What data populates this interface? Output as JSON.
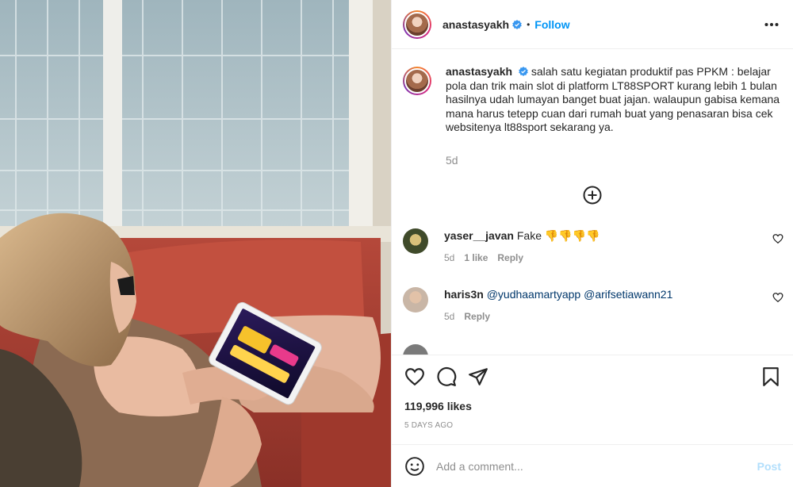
{
  "post": {
    "author": "anastasyakh",
    "follow_label": "Follow",
    "dot": "•",
    "caption": "salah satu kegiatan produktif pas PPKM : belajar pola dan trik main slot di platform LT88SPORT kurang lebih 1 bulan hasilnya udah lumayan banget buat jajan. walaupun gabisa kemana mana harus tetepp cuan dari rumah buat yang penasaran bisa cek websitenya lt88sport sekarang ya.",
    "caption_age": "5d",
    "likes": "119,996 likes",
    "posted": "5 DAYS AGO"
  },
  "comments": [
    {
      "user": "yaser__javan",
      "text": "Fake 👎👎👎👎",
      "age": "5d",
      "likes": "1 like",
      "reply": "Reply"
    },
    {
      "user": "haris3n",
      "mention1": "@yudhaamartyapp",
      "mention2": "@arifsetiawann21",
      "age": "5d",
      "reply": "Reply"
    }
  ],
  "add_comment": {
    "placeholder": "Add a comment...",
    "post_label": "Post"
  },
  "icons": {
    "more": "more-horizontal-icon",
    "load_more": "plus-circle-icon",
    "like": "heart-icon",
    "comment": "comment-icon",
    "share": "paper-plane-icon",
    "save": "bookmark-icon",
    "emoji": "smiley-icon",
    "verified": "verified-badge-icon"
  },
  "colors": {
    "link": "#0095f6",
    "muted": "#8e8e8e",
    "post_disabled": "#b2dffc"
  }
}
